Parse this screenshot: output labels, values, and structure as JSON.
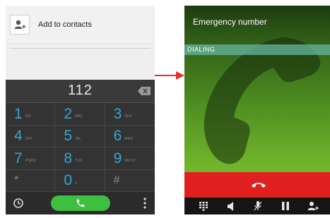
{
  "dialer": {
    "add_to_contacts": "Add to contacts",
    "number": "112",
    "keys": [
      {
        "digit": "1",
        "letters": "QO"
      },
      {
        "digit": "2",
        "letters": "ABC"
      },
      {
        "digit": "3",
        "letters": "DEF"
      },
      {
        "digit": "4",
        "letters": "GHI"
      },
      {
        "digit": "5",
        "letters": "JKL"
      },
      {
        "digit": "6",
        "letters": "MNO"
      },
      {
        "digit": "7",
        "letters": "PQRS"
      },
      {
        "digit": "8",
        "letters": "TUV"
      },
      {
        "digit": "9",
        "letters": "WXYZ"
      },
      {
        "digit": "*",
        "letters": ""
      },
      {
        "digit": "0",
        "letters": "+"
      },
      {
        "digit": "#",
        "letters": ""
      }
    ],
    "icons": {
      "add_contact": "add-contact-icon",
      "backspace": "backspace-icon",
      "history": "clock-icon",
      "call": "phone-icon",
      "menu": "overflow-menu-icon"
    }
  },
  "call_screen": {
    "title": "Emergency number",
    "status": "DIALING",
    "icons": {
      "end_call": "hang-up-icon",
      "dialpad": "dialpad-icon",
      "speaker": "speaker-icon",
      "mute": "mute-microphone-icon",
      "hold": "pause-icon",
      "add_call": "add-contact-icon"
    }
  },
  "colors": {
    "accent_blue": "#34a5d6",
    "call_green": "#3fbf3f",
    "end_call_red": "#e01f1f",
    "transition_arrow": "#e53030"
  }
}
